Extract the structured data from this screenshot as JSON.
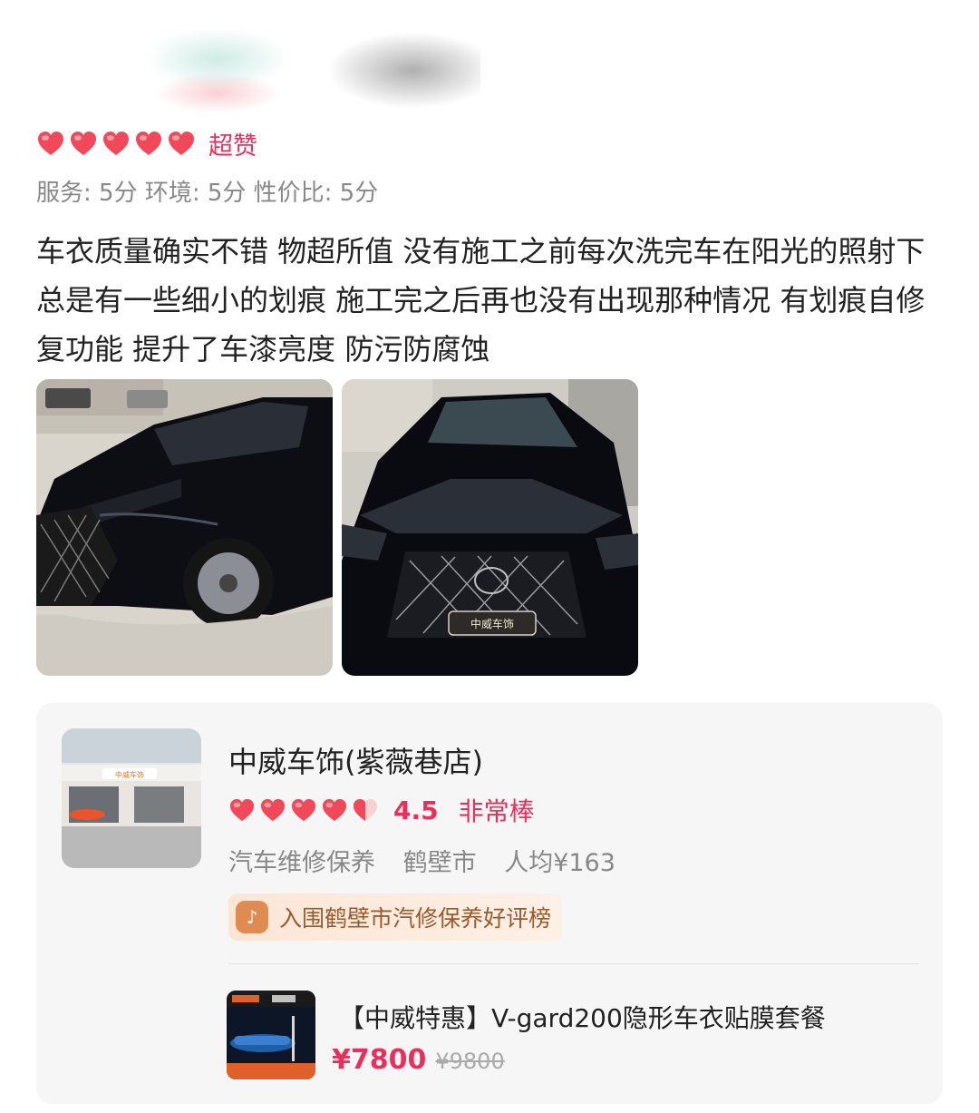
{
  "review": {
    "rating_label": "超赞",
    "sub_scores": "服务: 5分 环境: 5分 性价比: 5分",
    "text": "车衣质量确实不错 物超所值 没有施工之前每次洗完车在阳光的照射下总是有一些细小的划痕 施工完之后再也没有出现那种情况 有划痕自修复功能 提升了车漆亮度  防污防腐蚀",
    "hearts": 5,
    "photos": [
      {
        "description_icon": "car-photo-side"
      },
      {
        "description_icon": "car-photo-front",
        "plate_text": "中威车饰"
      }
    ]
  },
  "shop": {
    "name": "中威车饰(紫薇巷店)",
    "score": "4.5",
    "score_label": "非常棒",
    "hearts": 4.5,
    "category": "汽车维修保养",
    "city": "鹤壁市",
    "avg_price": "人均¥163",
    "rank_text": "入围鹤壁市汽修保养好评榜",
    "thumb_sign": "中威车饰",
    "deal": {
      "title": "【中威特惠】V-gard200隐形车衣贴膜套餐",
      "price": "¥7800",
      "original_price": "¥9800"
    }
  },
  "colors": {
    "accent": "#e8305c",
    "heart": "#f04a5a",
    "badge_text": "#9a5a2d"
  }
}
